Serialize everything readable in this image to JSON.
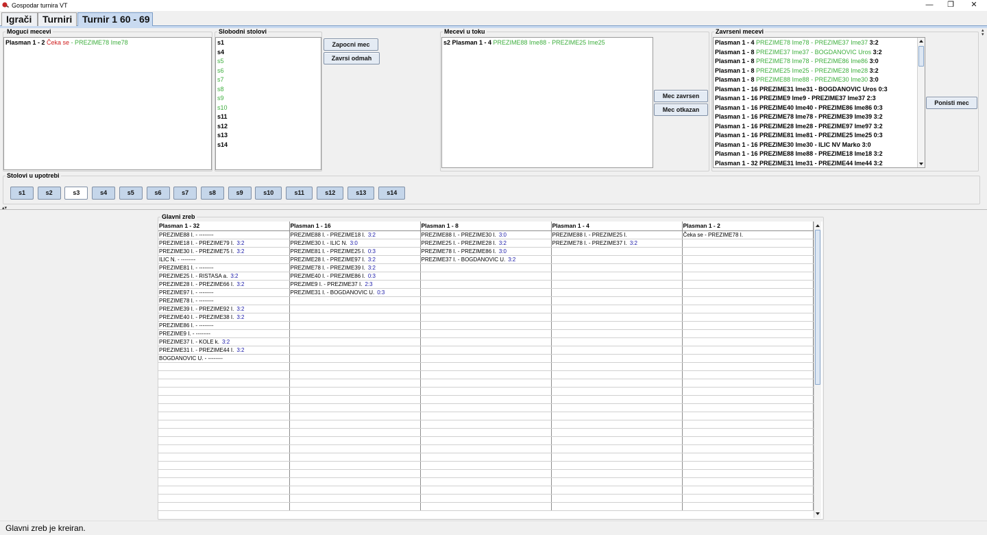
{
  "window": {
    "title": "Gospodar turnira VT",
    "minimize": "—",
    "restore": "❐",
    "close": "✕"
  },
  "tabs": [
    "Igrači",
    "Turniri",
    "Turnir 1 60 - 69"
  ],
  "moguci": {
    "label": "Moguci mecevi",
    "items": [
      {
        "a": "Plasman 1 - 2 ",
        "b": "Čeka se",
        "c": " - PREZIME78 Ime78"
      }
    ]
  },
  "slobodni": {
    "label": "Slobodni stolovi",
    "items": [
      {
        "name": "s1",
        "busy": false
      },
      {
        "name": "s4",
        "busy": false
      },
      {
        "name": "s5",
        "busy": true
      },
      {
        "name": "s6",
        "busy": true
      },
      {
        "name": "s7",
        "busy": true
      },
      {
        "name": "s8",
        "busy": true
      },
      {
        "name": "s9",
        "busy": true
      },
      {
        "name": "s10",
        "busy": true
      },
      {
        "name": "s11",
        "busy": false
      },
      {
        "name": "s12",
        "busy": false
      },
      {
        "name": "s13",
        "busy": false
      },
      {
        "name": "s14",
        "busy": false
      }
    ]
  },
  "buttons": {
    "zapocni": "Zapocni mec",
    "odmah": "Zavrsi odmah",
    "zavrsen": "Mec zavrsen",
    "otkazan": "Mec otkazan",
    "ponisti": "Ponisti mec"
  },
  "utoku": {
    "label": "Mecevi u toku",
    "items": [
      {
        "pre": "s2 Plasman 1 - 4 ",
        "p1": "PREZIME88 Ime88",
        "sep": " - ",
        "p2": "PREZIME25 Ime25"
      }
    ]
  },
  "zavrseni": {
    "label": "Zavrseni mecevi",
    "items": [
      {
        "pre": "Plasman 1 - 4 ",
        "p1": "PREZIME78 Ime78",
        "p2": "PREZIME37 Ime37",
        "score": "3:2",
        "green": true
      },
      {
        "pre": "Plasman 1 - 8 ",
        "p1": "PREZIME37 Ime37",
        "p2": "BOGDANOVIC Uros",
        "score": "3:2",
        "green": true
      },
      {
        "pre": "Plasman 1 - 8 ",
        "p1": "PREZIME78 Ime78",
        "p2": "PREZIME86 Ime86",
        "score": "3:0",
        "green": true
      },
      {
        "pre": "Plasman 1 - 8 ",
        "p1": "PREZIME25 Ime25",
        "p2": "PREZIME28 Ime28",
        "score": "3:2",
        "green": true
      },
      {
        "pre": "Plasman 1 - 8 ",
        "p1": "PREZIME88 Ime88",
        "p2": "PREZIME30 Ime30",
        "score": "3:0",
        "green": true
      },
      {
        "pre": "Plasman 1 - 16 ",
        "p1": "PREZIME31 Ime31",
        "p2": "BOGDANOVIC Uros",
        "score": "0:3",
        "green": false
      },
      {
        "pre": "Plasman 1 - 16 ",
        "p1": "PREZIME9 Ime9",
        "p2": "PREZIME37 Ime37",
        "score": "2:3",
        "green": false
      },
      {
        "pre": "Plasman 1 - 16 ",
        "p1": "PREZIME40 Ime40",
        "p2": "PREZIME86 Ime86",
        "score": "0:3",
        "green": false
      },
      {
        "pre": "Plasman 1 - 16 ",
        "p1": "PREZIME78 Ime78",
        "p2": "PREZIME39 Ime39",
        "score": "3:2",
        "green": false
      },
      {
        "pre": "Plasman 1 - 16 ",
        "p1": "PREZIME28 Ime28",
        "p2": "PREZIME97 Ime97",
        "score": "3:2",
        "green": false
      },
      {
        "pre": "Plasman 1 - 16 ",
        "p1": "PREZIME81 Ime81",
        "p2": "PREZIME25 Ime25",
        "score": "0:3",
        "green": false
      },
      {
        "pre": "Plasman 1 - 16 ",
        "p1": "PREZIME30 Ime30",
        "p2": "ILIC NV Marko",
        "score": "3:0",
        "green": false
      },
      {
        "pre": "Plasman 1 - 16 ",
        "p1": "PREZIME88 Ime88",
        "p2": "PREZIME18 Ime18",
        "score": "3:2",
        "green": false
      },
      {
        "pre": "Plasman 1 - 32 ",
        "p1": "PREZIME31 Ime31",
        "p2": "PREZIME44 Ime44",
        "score": "3:2",
        "green": false
      }
    ]
  },
  "stolovi": {
    "label": "Stolovi u upotrebi",
    "tables": [
      "s1",
      "s2",
      "s3",
      "s4",
      "s5",
      "s6",
      "s7",
      "s8",
      "s9",
      "s10",
      "s11",
      "s12",
      "s13",
      "s14"
    ],
    "selected": "s3"
  },
  "glavni": {
    "label": "Glavni zreb",
    "columns": [
      "Plasman 1 - 32",
      "Plasman 1 - 16",
      "Plasman 1 - 8",
      "Plasman 1 - 4",
      "Plasman 1 - 2"
    ],
    "rows": [
      [
        [
          "PREZIME88 I. - --------",
          ""
        ],
        [
          "PREZIME88 I. - PREZIME18 I.",
          "3:2"
        ],
        [
          "PREZIME88 I. - PREZIME30 I.",
          "3:0"
        ],
        [
          "PREZIME88 I. - PREZIME25 I.",
          ""
        ],
        [
          "Čeka se - PREZIME78 I.",
          ""
        ]
      ],
      [
        [
          "PREZIME18 I. - PREZIME79 I.",
          "3:2"
        ],
        [
          "PREZIME30 I. - ILIC N.",
          "3:0"
        ],
        [
          "PREZIME25 I. - PREZIME28 I.",
          "3:2"
        ],
        [
          "PREZIME78 I. - PREZIME37 I.",
          "3:2"
        ],
        [
          "",
          ""
        ]
      ],
      [
        [
          "PREZIME30 I. - PREZIME75 I.",
          "3:2"
        ],
        [
          "PREZIME81 I. - PREZIME25 I.",
          "0:3"
        ],
        [
          "PREZIME78 I. - PREZIME86 I.",
          "3:0"
        ],
        [
          "",
          ""
        ],
        [
          "",
          ""
        ]
      ],
      [
        [
          "ILIC N. - --------",
          ""
        ],
        [
          "PREZIME28 I. - PREZIME97 I.",
          "3:2"
        ],
        [
          "PREZIME37 I. - BOGDANOVIC U.",
          "3:2"
        ],
        [
          "",
          ""
        ],
        [
          "",
          ""
        ]
      ],
      [
        [
          "PREZIME81 I. - --------",
          ""
        ],
        [
          "PREZIME78 I. - PREZIME39 I.",
          "3:2"
        ],
        [
          "",
          ""
        ],
        [
          "",
          ""
        ],
        [
          "",
          ""
        ]
      ],
      [
        [
          "PREZIME25 I. - RISTASA a.",
          "3:2"
        ],
        [
          "PREZIME40 I. - PREZIME86 I.",
          "0:3"
        ],
        [
          "",
          ""
        ],
        [
          "",
          ""
        ],
        [
          "",
          ""
        ]
      ],
      [
        [
          "PREZIME28 I. - PREZIME66 I.",
          "3:2"
        ],
        [
          "PREZIME9 I. - PREZIME37 I.",
          "2:3"
        ],
        [
          "",
          ""
        ],
        [
          "",
          ""
        ],
        [
          "",
          ""
        ]
      ],
      [
        [
          "PREZIME97 I. - --------",
          ""
        ],
        [
          "PREZIME31 I. - BOGDANOVIC U.",
          "0:3"
        ],
        [
          "",
          ""
        ],
        [
          "",
          ""
        ],
        [
          "",
          ""
        ]
      ],
      [
        [
          "PREZIME78 I. - --------",
          ""
        ],
        [
          "",
          ""
        ],
        [
          "",
          ""
        ],
        [
          "",
          ""
        ],
        [
          "",
          ""
        ]
      ],
      [
        [
          "PREZIME39 I. - PREZIME92 I.",
          "3:2"
        ],
        [
          "",
          ""
        ],
        [
          "",
          ""
        ],
        [
          "",
          ""
        ],
        [
          "",
          ""
        ]
      ],
      [
        [
          "PREZIME40 I. - PREZIME38 I.",
          "3:2"
        ],
        [
          "",
          ""
        ],
        [
          "",
          ""
        ],
        [
          "",
          ""
        ],
        [
          "",
          ""
        ]
      ],
      [
        [
          "PREZIME86 I. - --------",
          ""
        ],
        [
          "",
          ""
        ],
        [
          "",
          ""
        ],
        [
          "",
          ""
        ],
        [
          "",
          ""
        ]
      ],
      [
        [
          "PREZIME9 I. - --------",
          ""
        ],
        [
          "",
          ""
        ],
        [
          "",
          ""
        ],
        [
          "",
          ""
        ],
        [
          "",
          ""
        ]
      ],
      [
        [
          "PREZIME37 I. - KOLE k.",
          "3:2"
        ],
        [
          "",
          ""
        ],
        [
          "",
          ""
        ],
        [
          "",
          ""
        ],
        [
          "",
          ""
        ]
      ],
      [
        [
          "PREZIME31 I. - PREZIME44 I.",
          "3:2"
        ],
        [
          "",
          ""
        ],
        [
          "",
          ""
        ],
        [
          "",
          ""
        ],
        [
          "",
          ""
        ]
      ],
      [
        [
          "BOGDANOVIC U. - --------",
          ""
        ],
        [
          "",
          ""
        ],
        [
          "",
          ""
        ],
        [
          "",
          ""
        ],
        [
          "",
          ""
        ]
      ]
    ]
  },
  "status": "Glavni zreb je kreiran.",
  "colors": {
    "green": "#3dae3d",
    "red": "#d02020",
    "score": "#1a1aa8",
    "tab_active": "#c9daf0"
  }
}
